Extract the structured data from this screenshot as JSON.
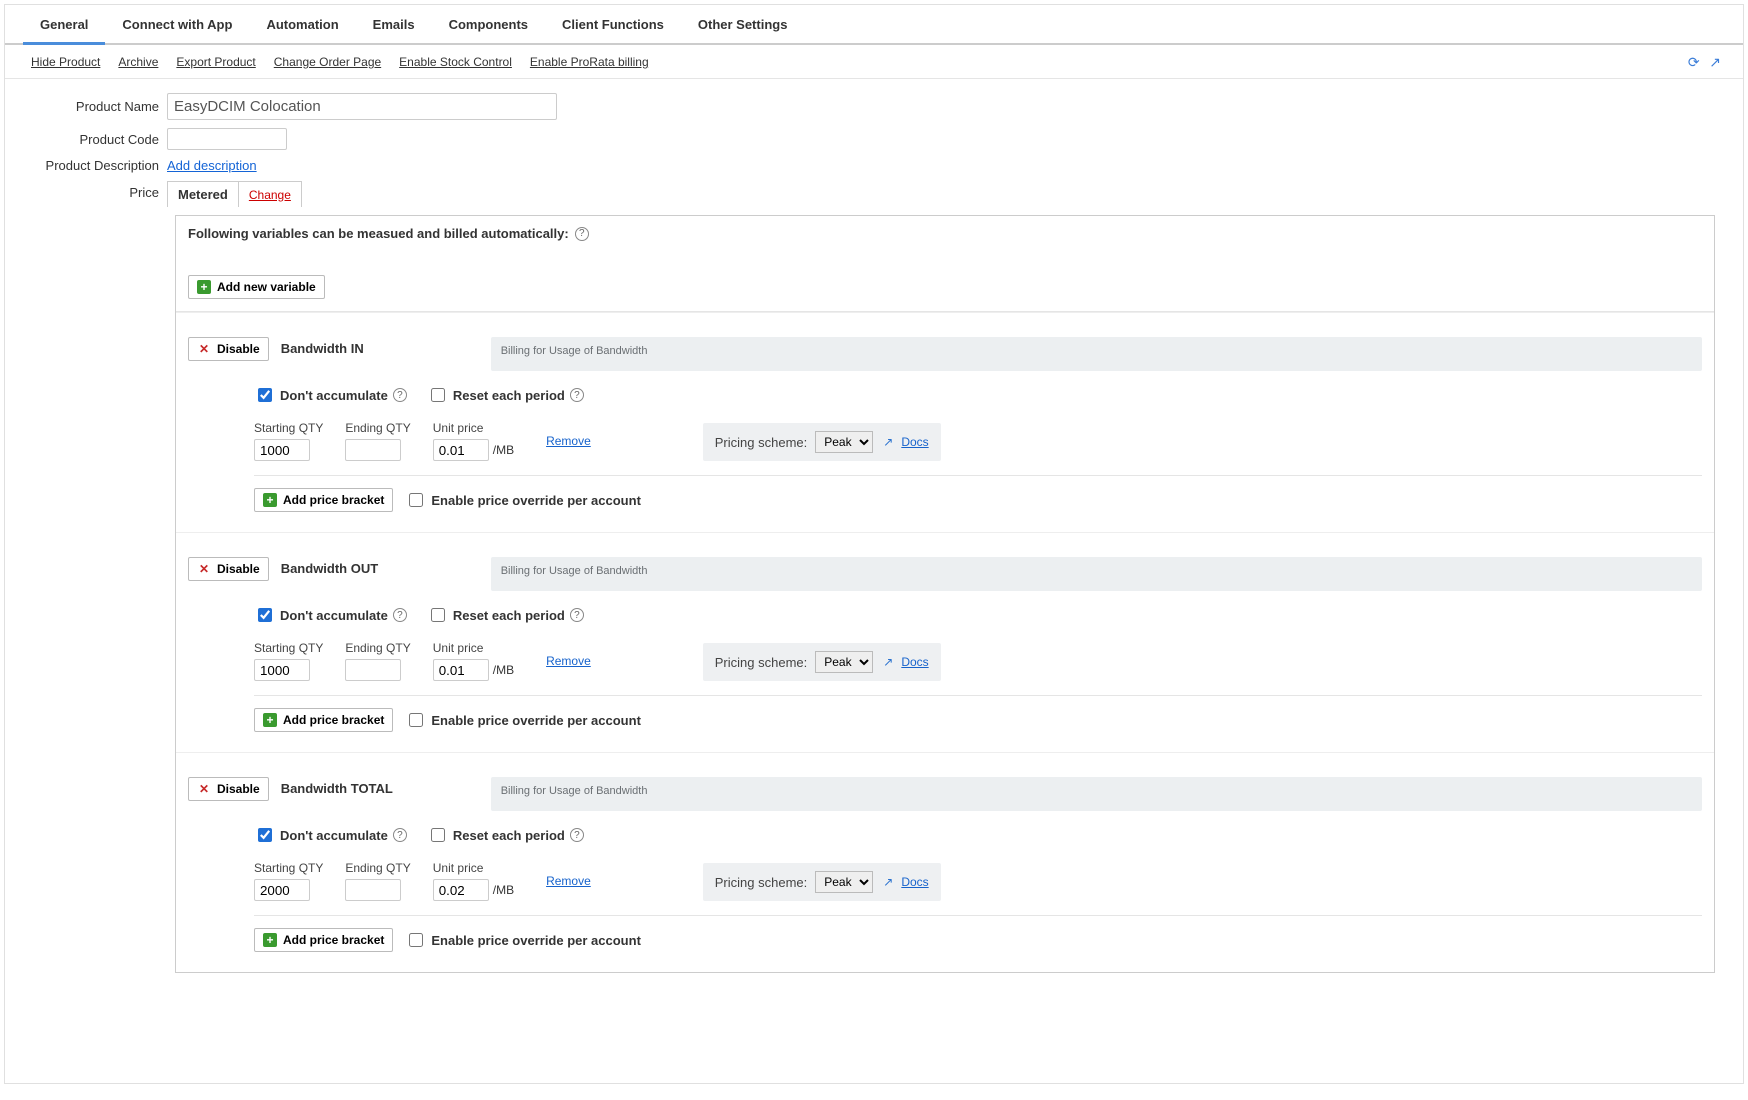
{
  "tabs": [
    "General",
    "Connect with App",
    "Automation",
    "Emails",
    "Components",
    "Client Functions",
    "Other Settings"
  ],
  "sublinks": [
    "Hide Product",
    "Archive",
    "Export Product",
    "Change Order Page",
    "Enable Stock Control",
    "Enable ProRata billing"
  ],
  "labels": {
    "product_name": "Product Name",
    "product_code": "Product Code",
    "product_desc": "Product Description",
    "price": "Price"
  },
  "product_name_value": "EasyDCIM Colocation",
  "product_code_value": "",
  "add_description": "Add description",
  "price_mode": "Metered",
  "change": "Change",
  "following_text": "Following variables can be measued and billed automatically:",
  "add_variable": "Add new variable",
  "dont_accumulate": "Don't accumulate",
  "reset_each": "Reset each period",
  "starting_qty": "Starting QTY",
  "ending_qty": "Ending QTY",
  "unit_price": "Unit price",
  "unit_suffix": "/MB",
  "remove": "Remove",
  "pricing_scheme": "Pricing scheme:",
  "scheme_value": "Peak",
  "docs": "Docs",
  "add_bracket": "Add price bracket",
  "enable_override": "Enable price override per account",
  "disable": "Disable",
  "variables": [
    {
      "title": "Bandwidth IN",
      "desc": "Billing for Usage of Bandwidth",
      "dont_accumulate": true,
      "reset": false,
      "starting": "1000",
      "ending": "",
      "unit_price": "0.01",
      "scheme": "Peak",
      "override": false
    },
    {
      "title": "Bandwidth OUT",
      "desc": "Billing for Usage of Bandwidth",
      "dont_accumulate": true,
      "reset": false,
      "starting": "1000",
      "ending": "",
      "unit_price": "0.01",
      "scheme": "Peak",
      "override": false
    },
    {
      "title": "Bandwidth TOTAL",
      "desc": "Billing for Usage of Bandwidth",
      "dont_accumulate": true,
      "reset": false,
      "starting": "2000",
      "ending": "",
      "unit_price": "0.02",
      "scheme": "Peak",
      "override": false
    }
  ]
}
